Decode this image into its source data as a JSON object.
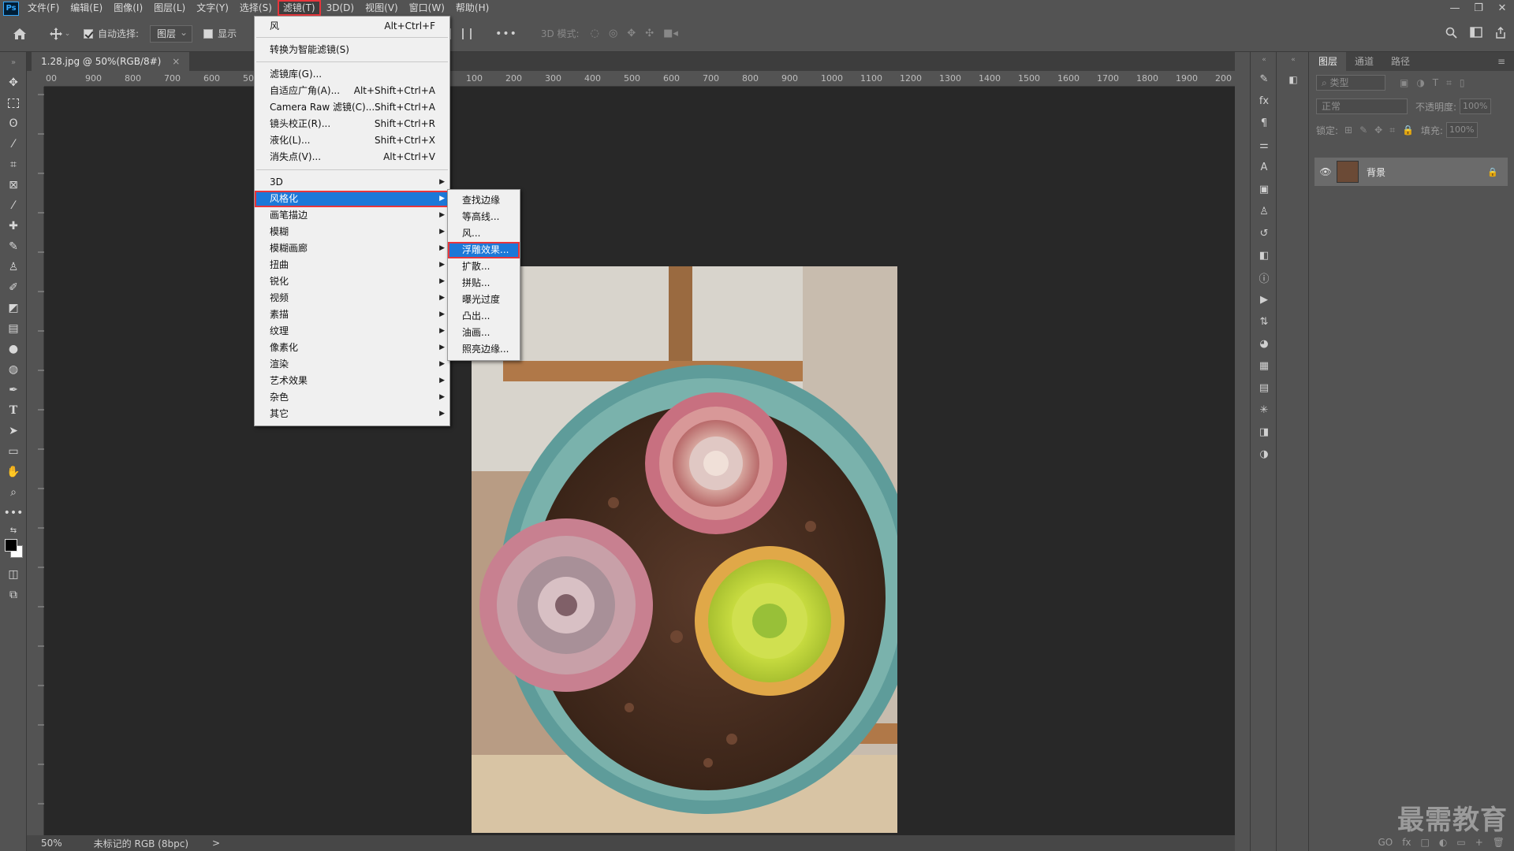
{
  "app": {
    "logo": "Ps"
  },
  "menubar": {
    "items": [
      "文件(F)",
      "编辑(E)",
      "图像(I)",
      "图层(L)",
      "文字(Y)",
      "选择(S)",
      "滤镜(T)",
      "3D(D)",
      "视图(V)",
      "窗口(W)",
      "帮助(H)"
    ],
    "active": "滤镜(T)"
  },
  "window_controls": {
    "minimize": "—",
    "restore": "❐",
    "close": "✕"
  },
  "options": {
    "auto_select_label": "自动选择:",
    "auto_select_checked": true,
    "target_value": "图层",
    "show_transform_label": "显示",
    "mode_3d_label": "3D 模式:",
    "more": "•••"
  },
  "document": {
    "tab_title": "1.28.jpg @ 50%(RGB/8#)",
    "tab_close": "×",
    "zoom": "50%",
    "status": "未标记的 RGB (8bpc)",
    "status_arrow": ">"
  },
  "ruler": {
    "h_ticks": [
      "00",
      "900",
      "800",
      "700",
      "600",
      "500",
      "100",
      "200",
      "300",
      "400",
      "500",
      "600",
      "700",
      "800",
      "900",
      "1000",
      "1100",
      "1200",
      "1300",
      "1400",
      "1500",
      "1600",
      "1700",
      "1800",
      "1900",
      "200"
    ]
  },
  "filter_menu": {
    "items": [
      {
        "label": "风",
        "shortcut": "Alt+Ctrl+F"
      },
      {
        "label": "转换为智能滤镜(S)",
        "shortcut": ""
      },
      {
        "label": "滤镜库(G)...",
        "shortcut": ""
      },
      {
        "label": "自适应广角(A)...",
        "shortcut": "Alt+Shift+Ctrl+A"
      },
      {
        "label": "Camera Raw 滤镜(C)...",
        "shortcut": "Shift+Ctrl+A"
      },
      {
        "label": "镜头校正(R)...",
        "shortcut": "Shift+Ctrl+R"
      },
      {
        "label": "液化(L)...",
        "shortcut": "Shift+Ctrl+X"
      },
      {
        "label": "消失点(V)...",
        "shortcut": "Alt+Ctrl+V"
      },
      {
        "label": "3D",
        "submenu": true
      },
      {
        "label": "风格化",
        "submenu": true,
        "highlighted": true
      },
      {
        "label": "画笔描边",
        "submenu": true
      },
      {
        "label": "模糊",
        "submenu": true
      },
      {
        "label": "模糊画廊",
        "submenu": true
      },
      {
        "label": "扭曲",
        "submenu": true
      },
      {
        "label": "锐化",
        "submenu": true
      },
      {
        "label": "视频",
        "submenu": true
      },
      {
        "label": "素描",
        "submenu": true
      },
      {
        "label": "纹理",
        "submenu": true
      },
      {
        "label": "像素化",
        "submenu": true
      },
      {
        "label": "渲染",
        "submenu": true
      },
      {
        "label": "艺术效果",
        "submenu": true
      },
      {
        "label": "杂色",
        "submenu": true
      },
      {
        "label": "其它",
        "submenu": true
      }
    ],
    "arrow": "▶"
  },
  "stylize_submenu": {
    "items": [
      "查找边缘",
      "等高线...",
      "风...",
      "浮雕效果...",
      "扩散...",
      "拼贴...",
      "曝光过度",
      "凸出...",
      "油画...",
      "照亮边缘..."
    ],
    "highlighted": "浮雕效果..."
  },
  "layers_panel": {
    "tabs": [
      "图层",
      "通道",
      "路径"
    ],
    "filter_placeholder": "类型",
    "blend_mode": "正常",
    "opacity_label": "不透明度:",
    "opacity_value": "100%",
    "lock_label": "锁定:",
    "fill_label": "填充:",
    "fill_value": "100%",
    "layer_name": "背景",
    "bottom_icons": [
      "GO",
      "fx",
      "□",
      "◐",
      "▭",
      "+",
      "🗑"
    ]
  },
  "watermark": "最需教育",
  "colors": {
    "menu_highlight": "#1c78d8",
    "annotation_red": "#e8353b",
    "canvas_bg": "#282828",
    "ui_gray": "#535353"
  }
}
